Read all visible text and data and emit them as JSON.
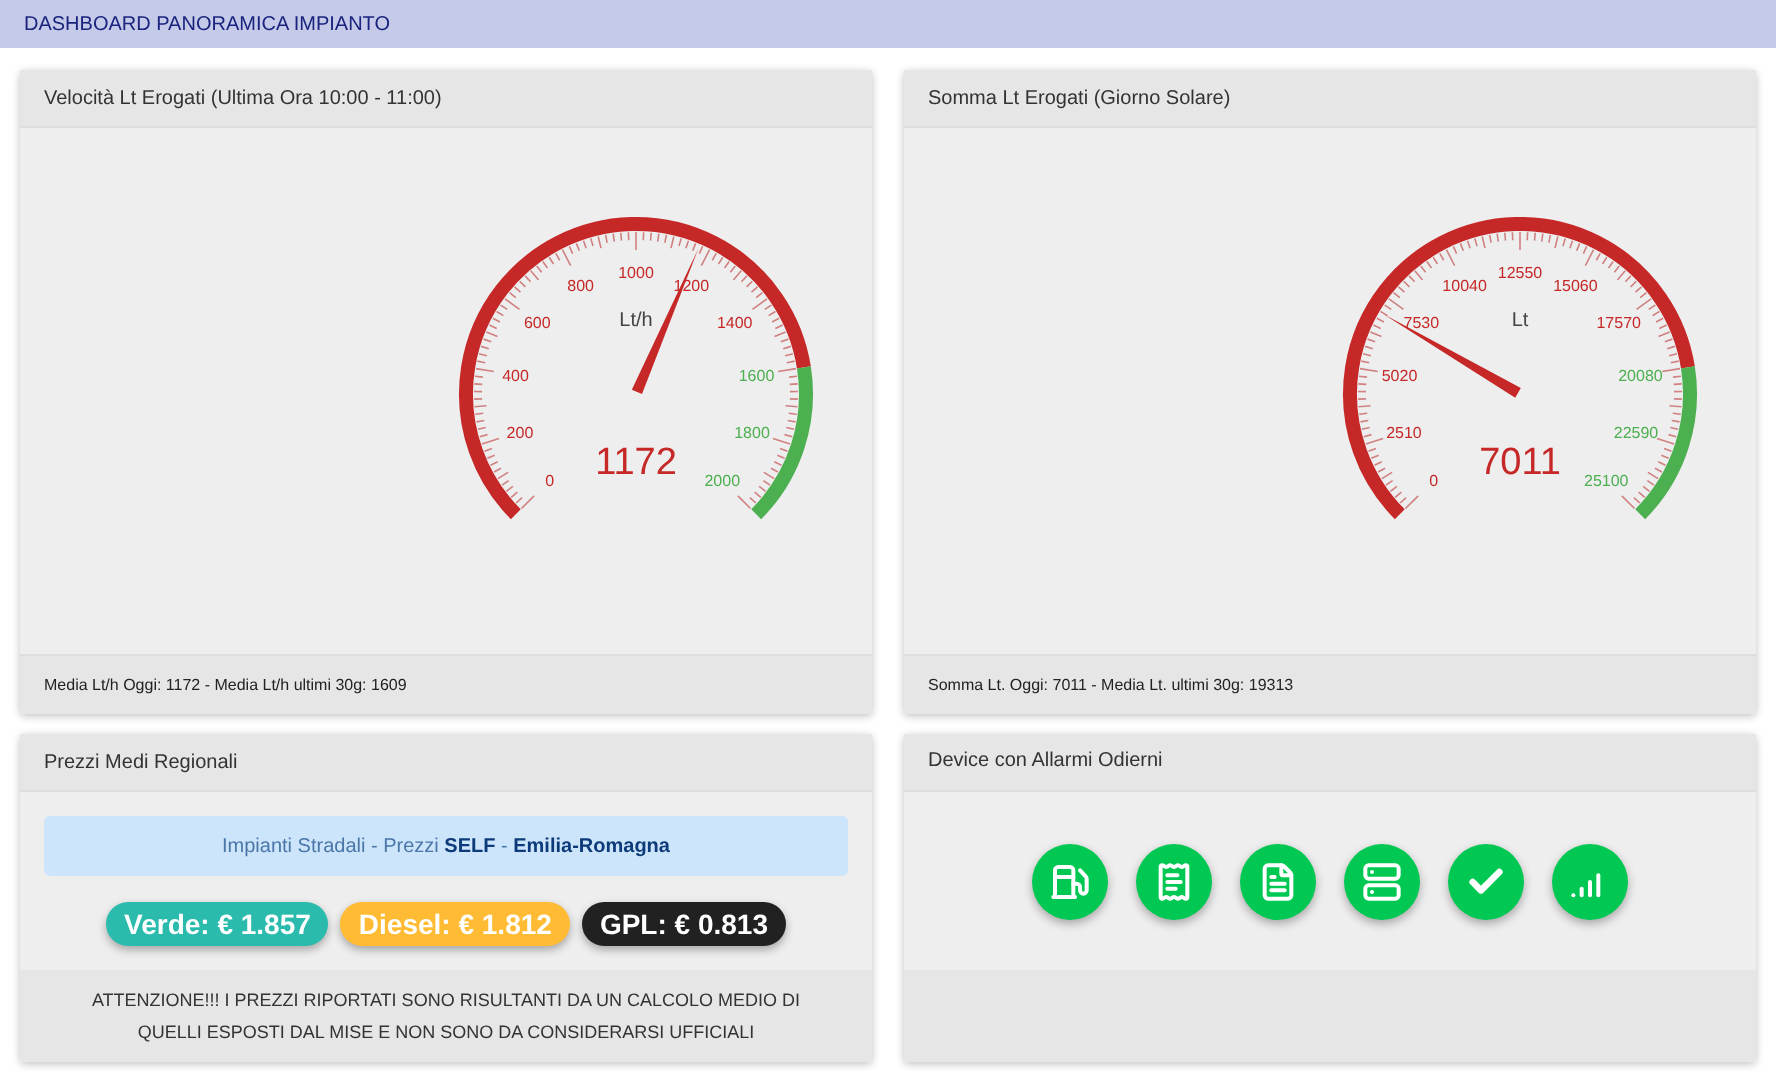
{
  "header": {
    "title": "DASHBOARD PANORAMICA IMPIANTO"
  },
  "gauges": [
    {
      "title": "Velocità Lt Erogati (Ultima Ora 10:00 - 11:00)",
      "unit": "Lt/h",
      "value": "1172",
      "level": 0.586,
      "ticks": [
        "0",
        "200",
        "400",
        "600",
        "800",
        "1000",
        "1200",
        "1400",
        "1600",
        "1800",
        "2000"
      ],
      "footer": "Media Lt/h Oggi: 1172 - Media Lt/h ultimi 30g: 1609"
    },
    {
      "title": "Somma Lt Erogati (Giorno Solare)",
      "unit": "Lt",
      "value": "7011",
      "level": 0.279,
      "ticks": [
        "0",
        "2510",
        "5020",
        "7530",
        "10040",
        "12550",
        "15060",
        "17570",
        "20080",
        "22590",
        "25100"
      ],
      "footer": "Somma Lt. Oggi: 7011 - Media Lt. ultimi 30g: 19313"
    }
  ],
  "prices": {
    "title": "Prezzi Medi Regionali",
    "info": "Impianti Stradali - Prezzi **SELF** - **Emilia-Romagna**",
    "badges": [
      {
        "label": "Verde: € 1.857",
        "color": "#2bbbad"
      },
      {
        "label": "Diesel: € 1.812",
        "color": "#ffbb33"
      },
      {
        "label": "GPL: € 0.813",
        "color": "#212121"
      }
    ],
    "notice": "ATTENZIONE!!! I PREZZI RIPORTATI SONO RISULTANTI DA UN CALCOLO MEDIO DI QUELLI ESPOSTI DAL MISE E NON SONO DA CONSIDERARSI UFFICIALI"
  },
  "alarms": {
    "title": "Device con Allarmi Odierni",
    "devices": [
      {
        "kind": "pump"
      },
      {
        "kind": "receipt"
      },
      {
        "kind": "document"
      },
      {
        "kind": "server"
      },
      {
        "kind": "check"
      },
      {
        "kind": "signal"
      }
    ]
  }
}
